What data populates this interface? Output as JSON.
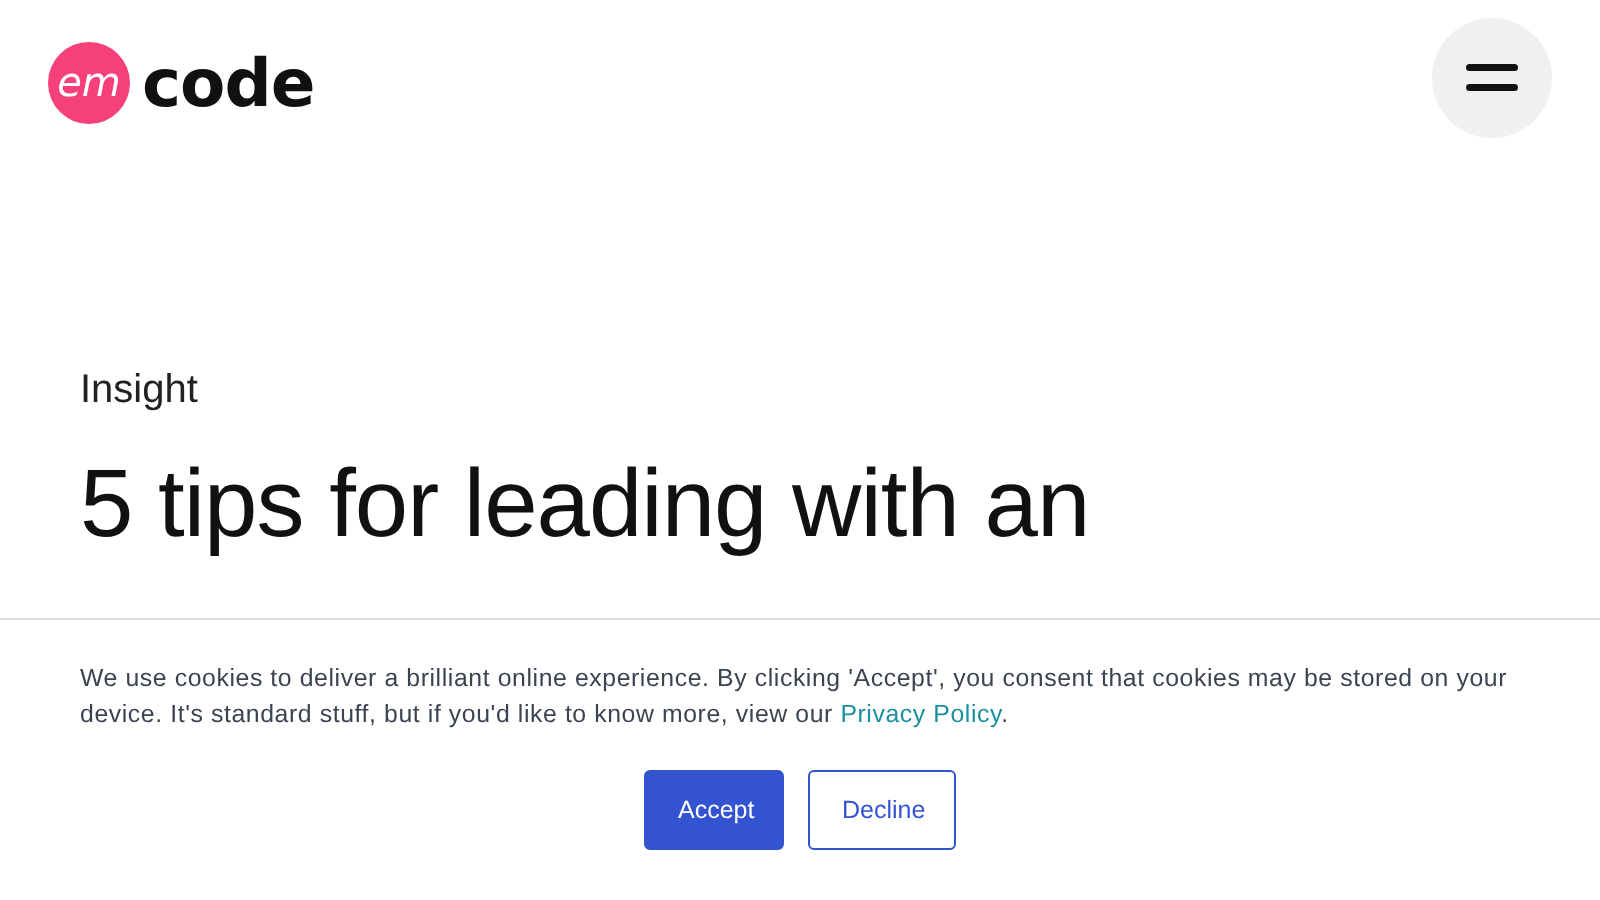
{
  "logo": {
    "badge": "em",
    "word": "code"
  },
  "article": {
    "category": "Insight",
    "title": "5 tips for leading with an"
  },
  "cookie_banner": {
    "text": "We use cookies to deliver a brilliant online experience. By clicking 'Accept', you consent that cookies may be stored on your device. It's standard stuff, but if you'd like to know more, view our",
    "link": "Privacy Policy",
    "after_link": ".",
    "buttons": [
      {
        "label": "Accept",
        "kind": "primary"
      },
      {
        "label": "Decline",
        "kind": "secondary"
      }
    ]
  }
}
